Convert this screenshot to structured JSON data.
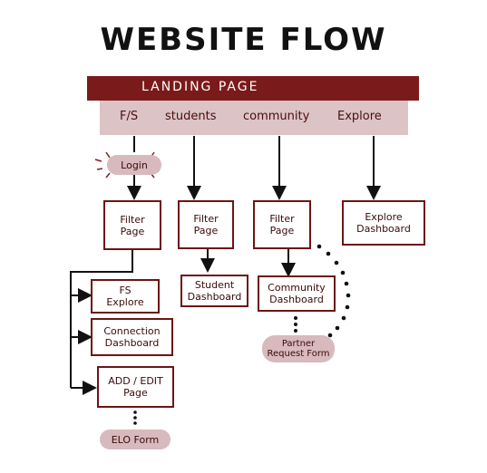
{
  "title": "WEBSITE FLOW",
  "landing": {
    "label": "LANDING PAGE"
  },
  "tabs": [
    "F/S",
    "students",
    "community",
    "Explore"
  ],
  "colors": {
    "maroon": "#6e1414",
    "band": "#7a1a1a",
    "pink": "#dcc3c6",
    "pill": "#d8b9bd"
  },
  "nodes": {
    "login": "Login",
    "filter_fs": "Filter\nPage",
    "filter_students": "Filter\nPage",
    "filter_community": "Filter\nPage",
    "explore_dashboard": "Explore\nDashboard",
    "fs_explore": "FS\nExplore",
    "student_dashboard": "Student\nDashboard",
    "community_dashboard": "Community\nDashboard",
    "connection_dashboard": "Connection\nDashboard",
    "add_edit_page": "ADD / EDIT\nPage",
    "partner_request_form": "Partner\nRequest Form",
    "elo_form": "ELO Form"
  }
}
